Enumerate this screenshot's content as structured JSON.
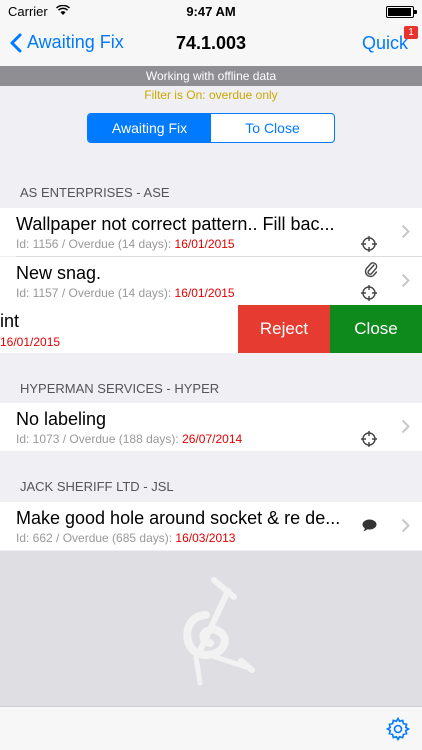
{
  "status_bar": {
    "carrier": "Carrier",
    "time": "9:47 AM"
  },
  "nav": {
    "back_label": "Awaiting Fix",
    "title": "74.1.003",
    "quick_label": "Quick",
    "quick_badge": "1"
  },
  "offline_banner": "Working with offline data",
  "filter_text": "Filter is On: overdue only",
  "segmented": {
    "options": [
      "Awaiting Fix",
      "To Close"
    ],
    "selected": "Awaiting Fix"
  },
  "sections": [
    {
      "header": "AS ENTERPRISES - ASE",
      "items": [
        {
          "title": "Wallpaper not correct pattern.. Fill bac...",
          "meta": "Id: 1156 / Overdue (14 days): ",
          "date": "16/01/2015",
          "icons": [
            "target-icon"
          ]
        },
        {
          "title": "New snag.",
          "meta": "Id: 1157 / Overdue (14 days): ",
          "date": "16/01/2015",
          "icons": [
            "paperclip-icon",
            "target-icon"
          ]
        },
        {
          "title": "int",
          "date": "16/01/2015",
          "swiped": true,
          "actions": [
            "Reject",
            "Close"
          ]
        }
      ]
    },
    {
      "header": "HYPERMAN SERVICES - HYPER",
      "items": [
        {
          "title": "No labeling",
          "meta": "Id: 1073 / Overdue (188 days): ",
          "date": "26/07/2014",
          "icons": [
            "target-icon"
          ]
        }
      ]
    },
    {
      "header": "JACK SHERIFF LTD - JSL",
      "items": [
        {
          "title": "Make good hole around socket & re de...",
          "meta": "Id: 662 / Overdue (685 days): ",
          "date": "16/03/2013",
          "icons": [
            "speech-bubble-icon"
          ]
        }
      ]
    }
  ],
  "colors": {
    "accent": "#007aff",
    "reject": "#e53b30",
    "close": "#0e8a1c",
    "overdue_date": "#e00000",
    "filter_text": "#c8a800"
  }
}
